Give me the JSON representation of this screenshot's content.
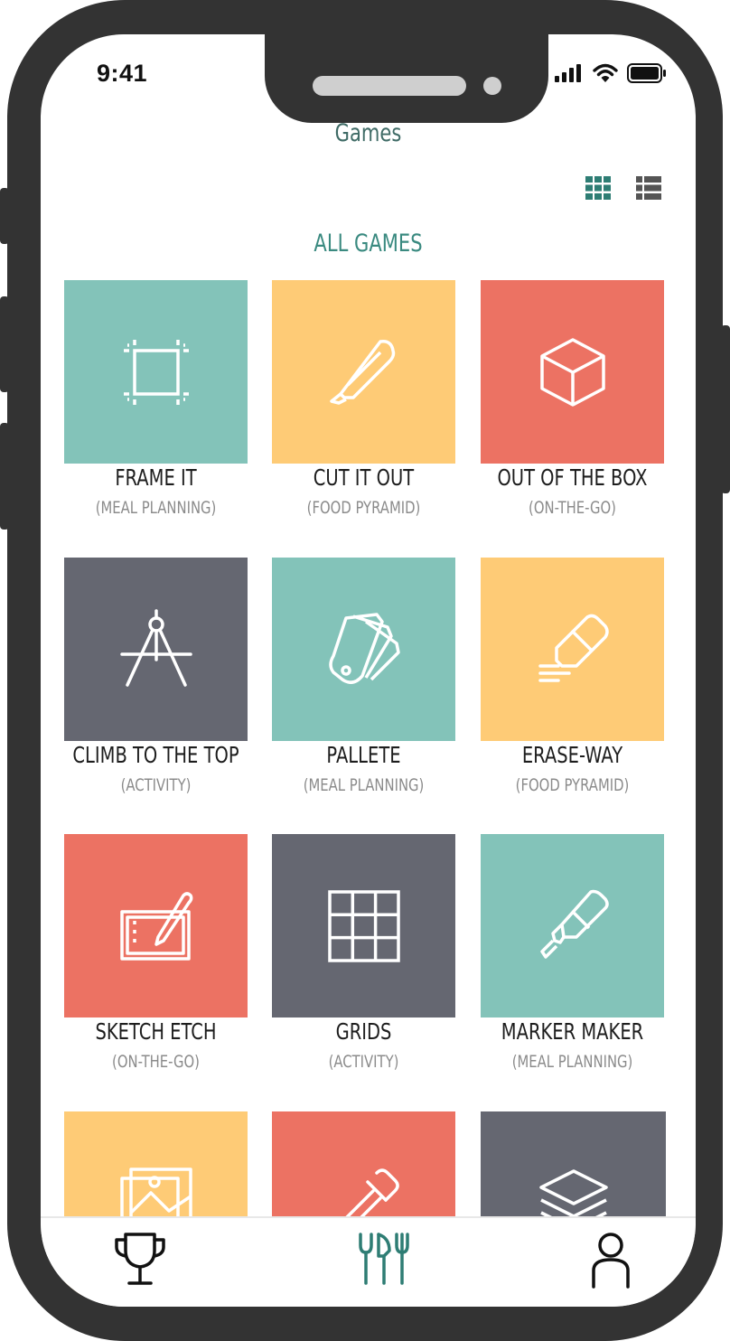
{
  "status": {
    "time": "9:41"
  },
  "header": {
    "title": "Games"
  },
  "view_toggle": {
    "grid_icon": "grid-view-icon",
    "list_icon": "list-view-icon",
    "active": "grid",
    "active_color": "#2e7d74",
    "inactive_color": "#555555"
  },
  "section": {
    "title": "ALL GAMES"
  },
  "colors": {
    "teal": "#83c3b9",
    "yellow": "#fecb76",
    "red": "#ec7263",
    "slate": "#656771"
  },
  "games": [
    {
      "name": "FRAME IT",
      "category": "(MEAL PLANNING)",
      "icon": "frame-icon",
      "color": "#83c3b9"
    },
    {
      "name": "CUT IT OUT",
      "category": "(FOOD PYRAMID)",
      "icon": "cutter-knife-icon",
      "color": "#fecb76"
    },
    {
      "name": "OUT OF THE BOX",
      "category": "(ON-THE-GO)",
      "icon": "cube-icon",
      "color": "#ec7263"
    },
    {
      "name": "CLIMB TO THE TOP",
      "category": "(ACTIVITY)",
      "icon": "compass-tool-icon",
      "color": "#656771"
    },
    {
      "name": "PALLETE",
      "category": "(MEAL PLANNING)",
      "icon": "swatch-icon",
      "color": "#83c3b9"
    },
    {
      "name": "ERASE-WAY",
      "category": "(FOOD PYRAMID)",
      "icon": "eraser-icon",
      "color": "#fecb76"
    },
    {
      "name": "SKETCH ETCH",
      "category": "(ON-THE-GO)",
      "icon": "drawing-tablet-icon",
      "color": "#ec7263"
    },
    {
      "name": "GRIDS",
      "category": "(ACTIVITY)",
      "icon": "grid-icon",
      "color": "#656771"
    },
    {
      "name": "MARKER MAKER",
      "category": "(MEAL PLANNING)",
      "icon": "marker-icon",
      "color": "#83c3b9"
    },
    {
      "name": "",
      "category": "",
      "icon": "image-icon",
      "color": "#fecb76"
    },
    {
      "name": "",
      "category": "",
      "icon": "eyedropper-icon",
      "color": "#ec7263"
    },
    {
      "name": "",
      "category": "",
      "icon": "layers-icon",
      "color": "#656771"
    }
  ],
  "tabbar": {
    "items": [
      {
        "icon": "trophy-icon",
        "color": "#111111"
      },
      {
        "icon": "fork-knife-icon",
        "color": "#2e7d74",
        "active": true
      },
      {
        "icon": "profile-icon",
        "color": "#111111"
      }
    ]
  }
}
